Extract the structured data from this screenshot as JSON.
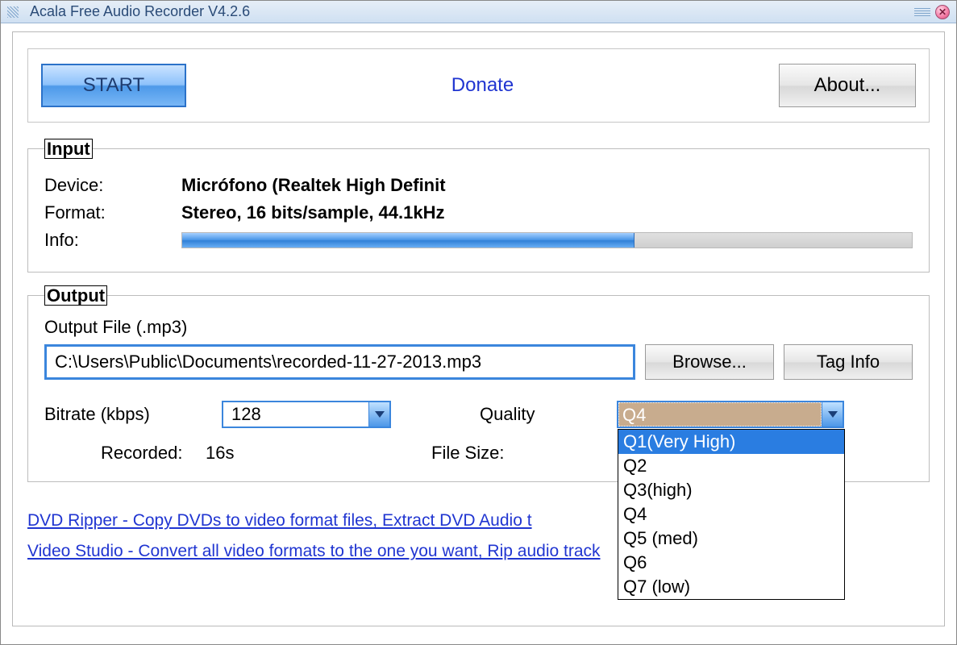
{
  "window": {
    "title": "Acala Free Audio Recorder V4.2.6"
  },
  "toolbar": {
    "start_label": "START",
    "donate_label": "Donate",
    "about_label": "About..."
  },
  "input": {
    "legend": "Input",
    "device_label": "Device:",
    "device_value": "Micrófono (Realtek High Definit",
    "format_label": "Format:",
    "format_value": "Stereo, 16 bits/sample, 44.1kHz",
    "info_label": "Info:",
    "level_percent": 62
  },
  "output": {
    "legend": "Output",
    "file_label": "Output File (.mp3)",
    "file_value": "C:\\Users\\Public\\Documents\\recorded-11-27-2013.mp3",
    "browse_label": "Browse...",
    "taginfo_label": "Tag Info",
    "bitrate_label": "Bitrate (kbps)",
    "bitrate_value": "128",
    "quality_label": "Quality",
    "quality_selected": "Q4",
    "quality_options": [
      "Q1(Very High)",
      "Q2",
      "Q3(high)",
      "Q4",
      "Q5 (med)",
      "Q6",
      "Q7 (low)"
    ],
    "quality_highlight_index": 0,
    "recorded_label": "Recorded:",
    "recorded_value": "16s",
    "filesize_label": "File Size:",
    "filesize_value": ""
  },
  "links": {
    "dvd": "DVD Ripper - Copy DVDs to video format files, Extract DVD Audio t",
    "video": "Video Studio - Convert all video formats to the one you want, Rip audio track"
  }
}
